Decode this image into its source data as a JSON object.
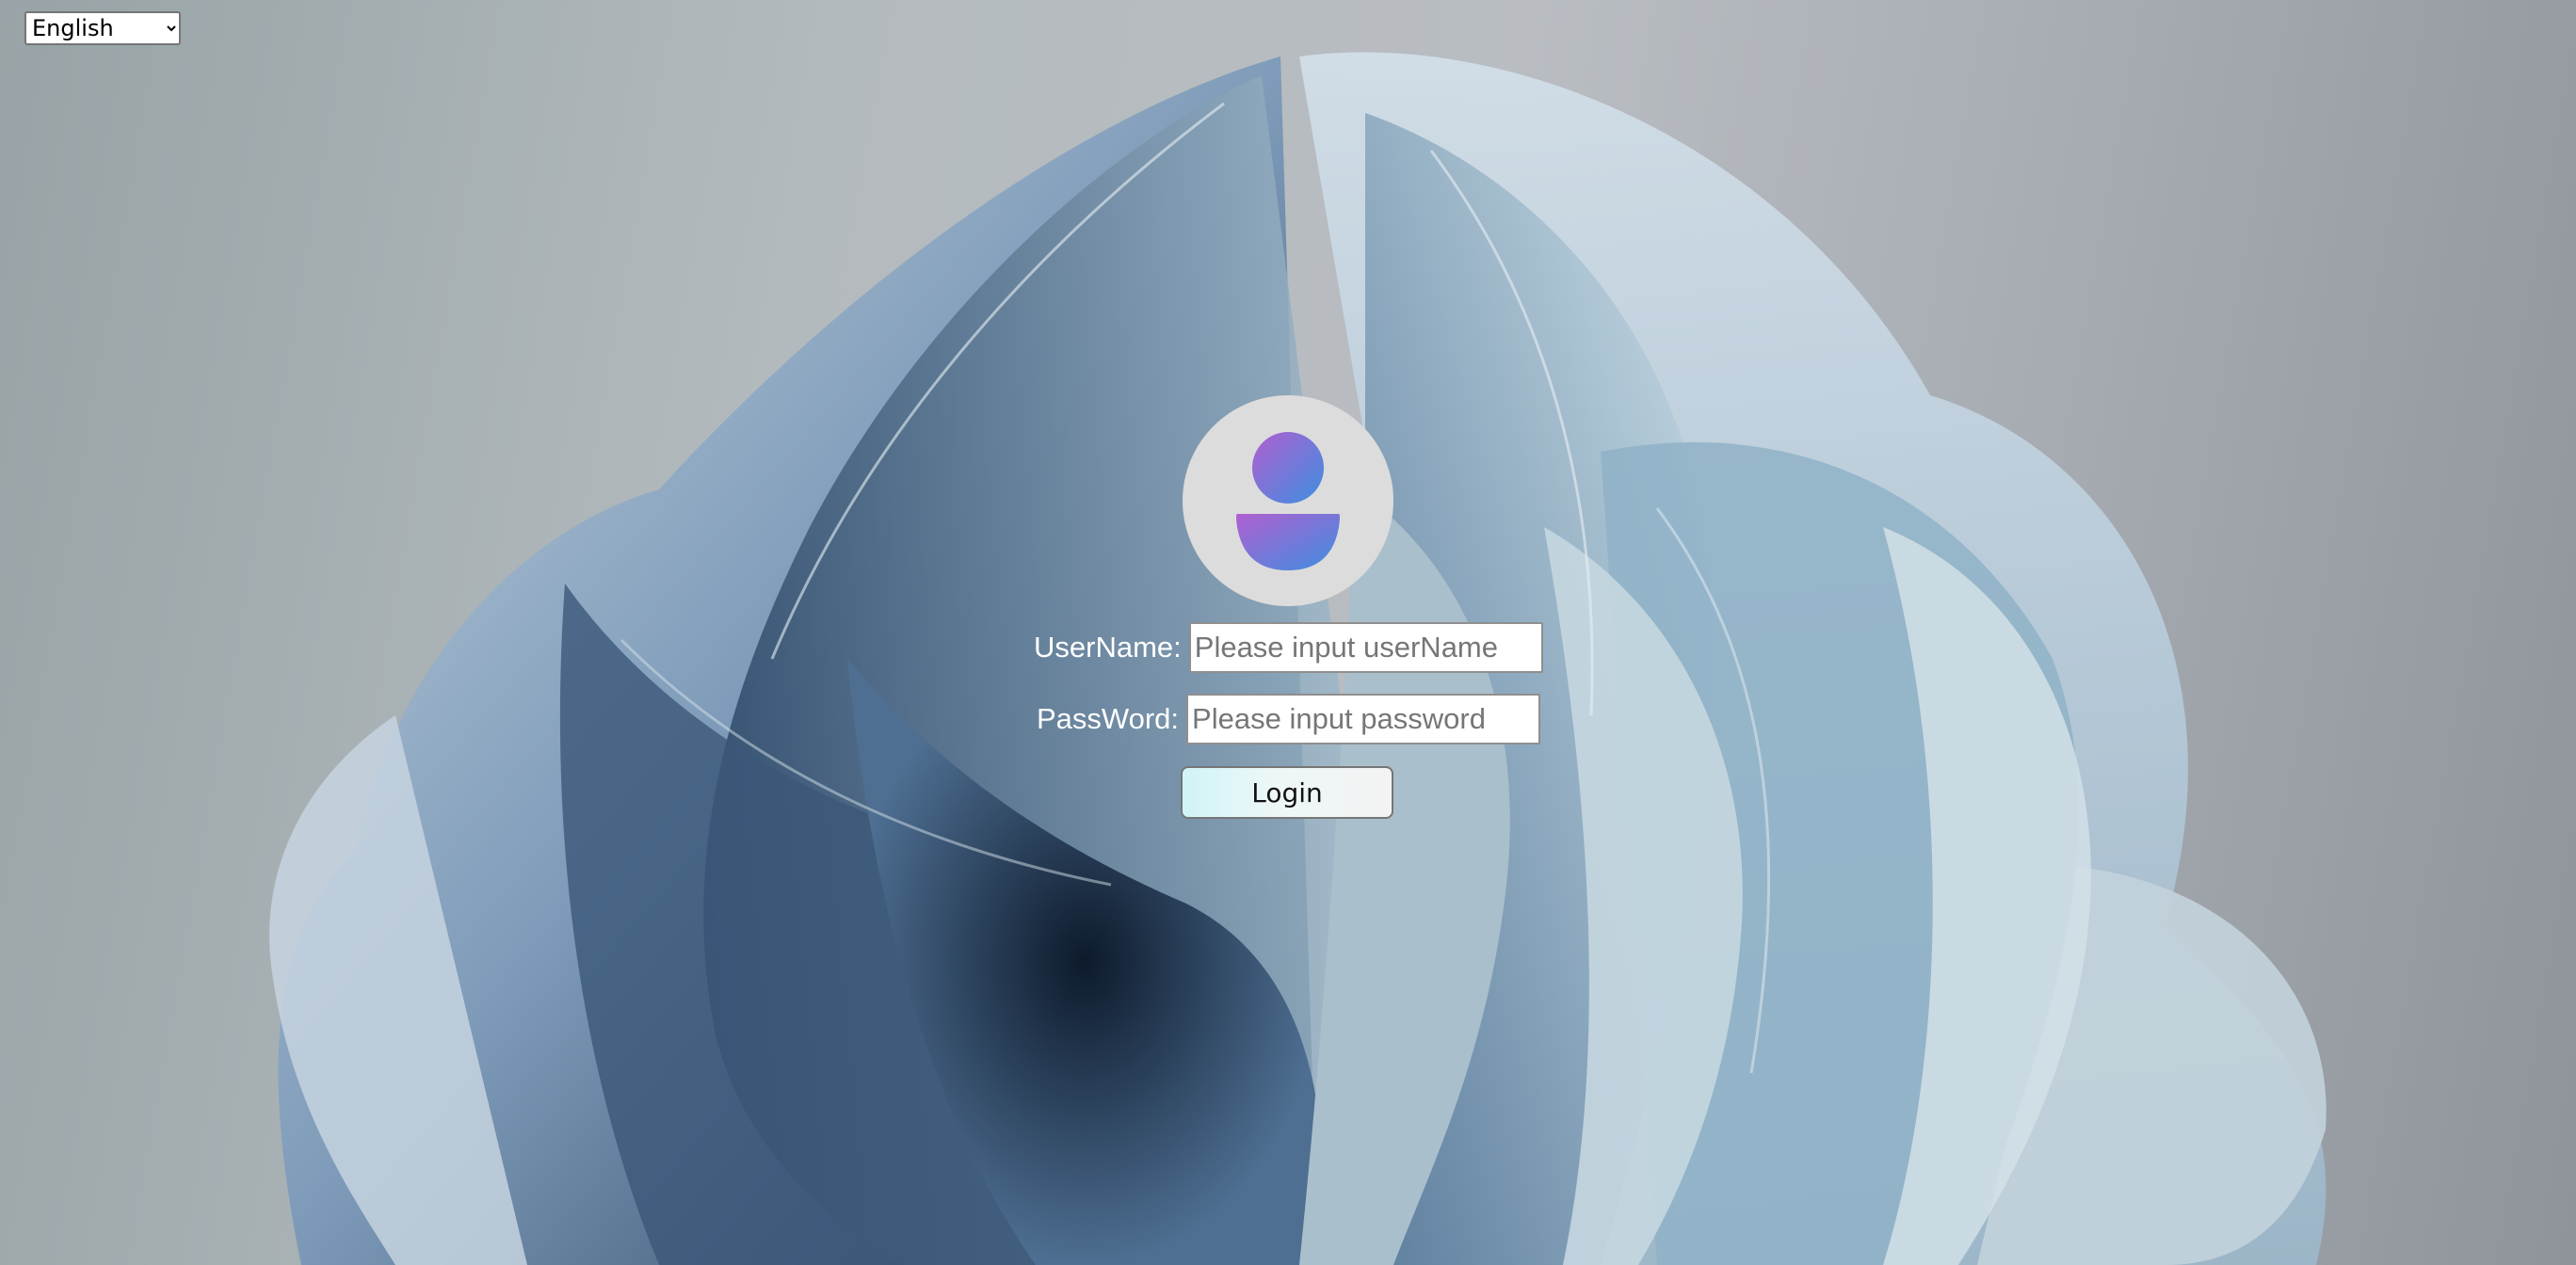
{
  "language": {
    "selected": "English",
    "options": [
      "English"
    ]
  },
  "login_form": {
    "username_label": "UserName:",
    "username_placeholder": "Please input userName",
    "username_value": "",
    "password_label": "PassWord:",
    "password_placeholder": "Please input password",
    "password_value": "",
    "login_label": "Login"
  },
  "icons": {
    "avatar": "user-avatar-icon",
    "select_arrow": "chevron-down-icon"
  },
  "colors": {
    "avatar_bg": "#dcdcdc",
    "avatar_gradient_start": "#b05fd0",
    "avatar_gradient_end": "#3d8fe0",
    "label_text": "#ffffff",
    "button_gradient_start": "#cff4f7"
  }
}
